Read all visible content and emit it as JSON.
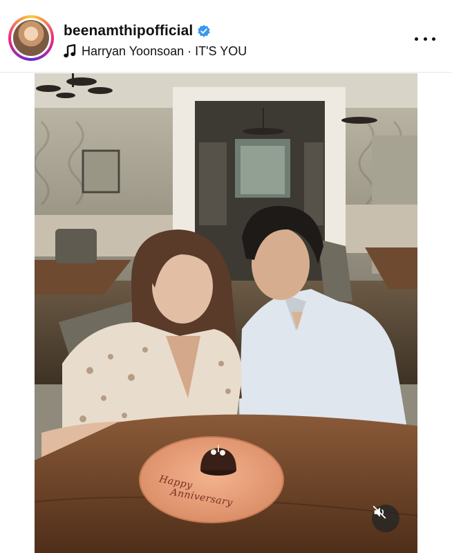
{
  "post": {
    "username": "beenamthipofficial",
    "verified": true,
    "music": "Harryan Yoonsoan · IT'S YOU"
  },
  "plate": {
    "line1": "Happy",
    "line2": "Anniversary"
  },
  "colors": {
    "verified_badge": "#3897f0",
    "mute_button_bg": "#262626"
  },
  "icons": [
    "verified-badge-icon",
    "music-note-icon",
    "more-options-icon",
    "muted-speaker-icon"
  ]
}
